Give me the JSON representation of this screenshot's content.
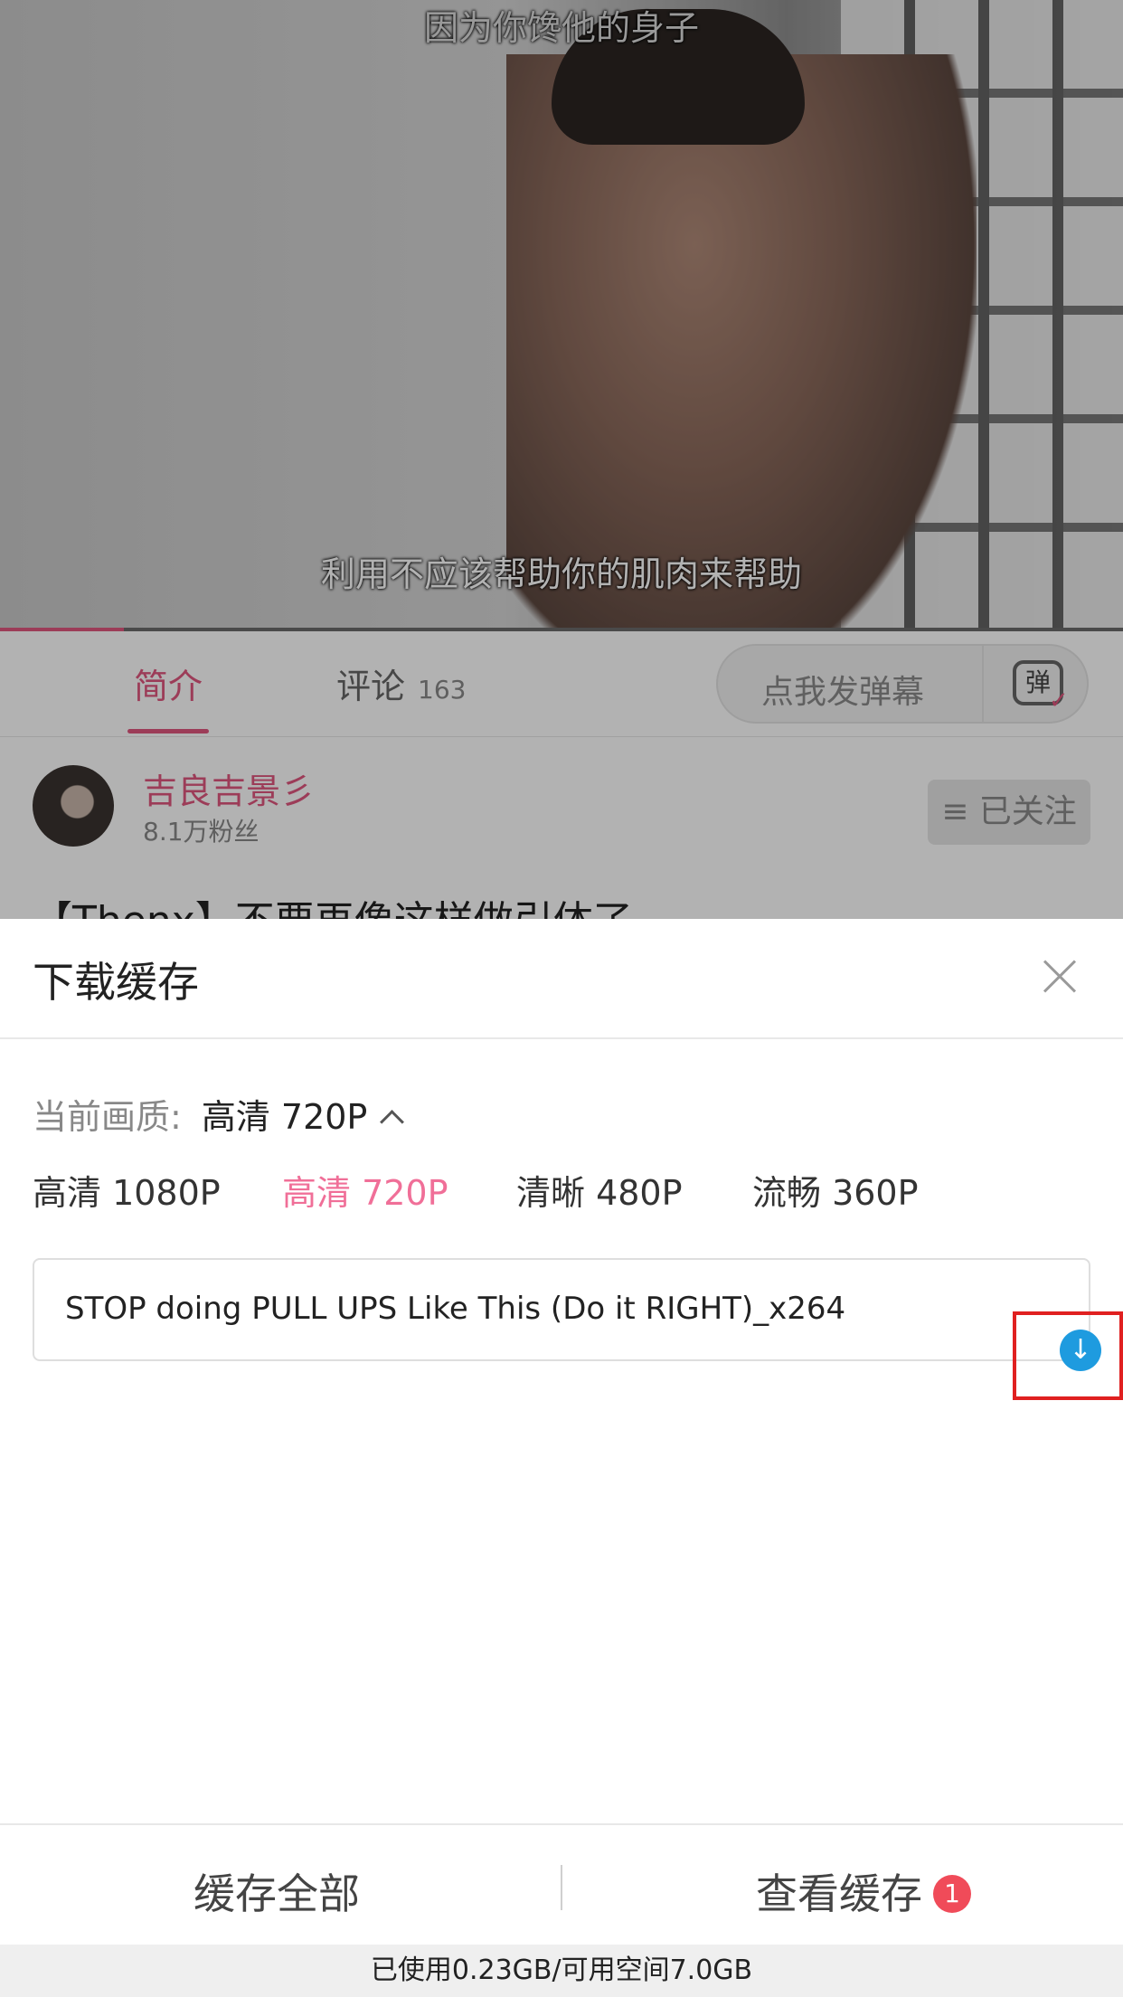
{
  "video": {
    "subtitle_top": "因为你馋他的身子",
    "subtitle_bottom": "利用不应该帮助你的肌肉来帮助",
    "progress_fraction": 0.11,
    "accent_color": "#e0577f"
  },
  "tabs": [
    {
      "label": "简介",
      "active": true
    },
    {
      "label": "评论",
      "count": "163",
      "active": false
    }
  ],
  "danmaku": {
    "placeholder": "点我发弹幕",
    "icon_glyph": "弹",
    "icon": "danmaku-tv-icon"
  },
  "author": {
    "name": "吉良吉景彡",
    "fans": "8.1万粉丝",
    "follow_label": "≡ 已关注"
  },
  "video_title": "【Thenx】不要再像这样做引体了",
  "sheet": {
    "title": "下载缓存",
    "close_icon": "close-icon",
    "quality_label": "当前画质:",
    "quality_current": "高清 720P",
    "quality_options": [
      {
        "label": "高清 1080P",
        "selected": false
      },
      {
        "label": "高清 720P",
        "selected": true
      },
      {
        "label": "清晰 480P",
        "selected": false
      },
      {
        "label": "流畅 360P",
        "selected": false
      }
    ],
    "file_name": "STOP doing PULL UPS Like This (Do it RIGHT)_x264",
    "download_icon": "download-arrow-icon",
    "download_color": "#1e9bdf",
    "footer": {
      "cache_all": "缓存全部",
      "view_cache": "查看缓存",
      "badge_count": "1"
    },
    "storage_text": "已使用0.23GB/可用空间7.0GB"
  }
}
